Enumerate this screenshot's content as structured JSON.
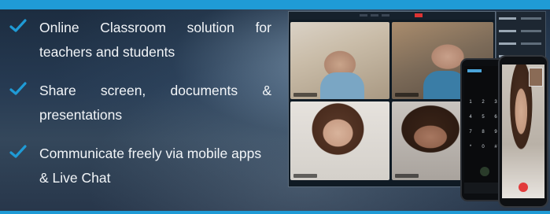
{
  "features": [
    {
      "lines": [
        "Online Classroom solution for",
        "teachers and students"
      ]
    },
    {
      "lines": [
        "Share screen, documents &",
        "presentations"
      ]
    },
    {
      "lines": [
        "Communicate freely via mobile apps",
        "& Live Chat"
      ]
    }
  ],
  "icons": {
    "bullet": "check-icon"
  },
  "colors": {
    "accent": "#1f9bd6",
    "text": "#f2f5f8"
  }
}
